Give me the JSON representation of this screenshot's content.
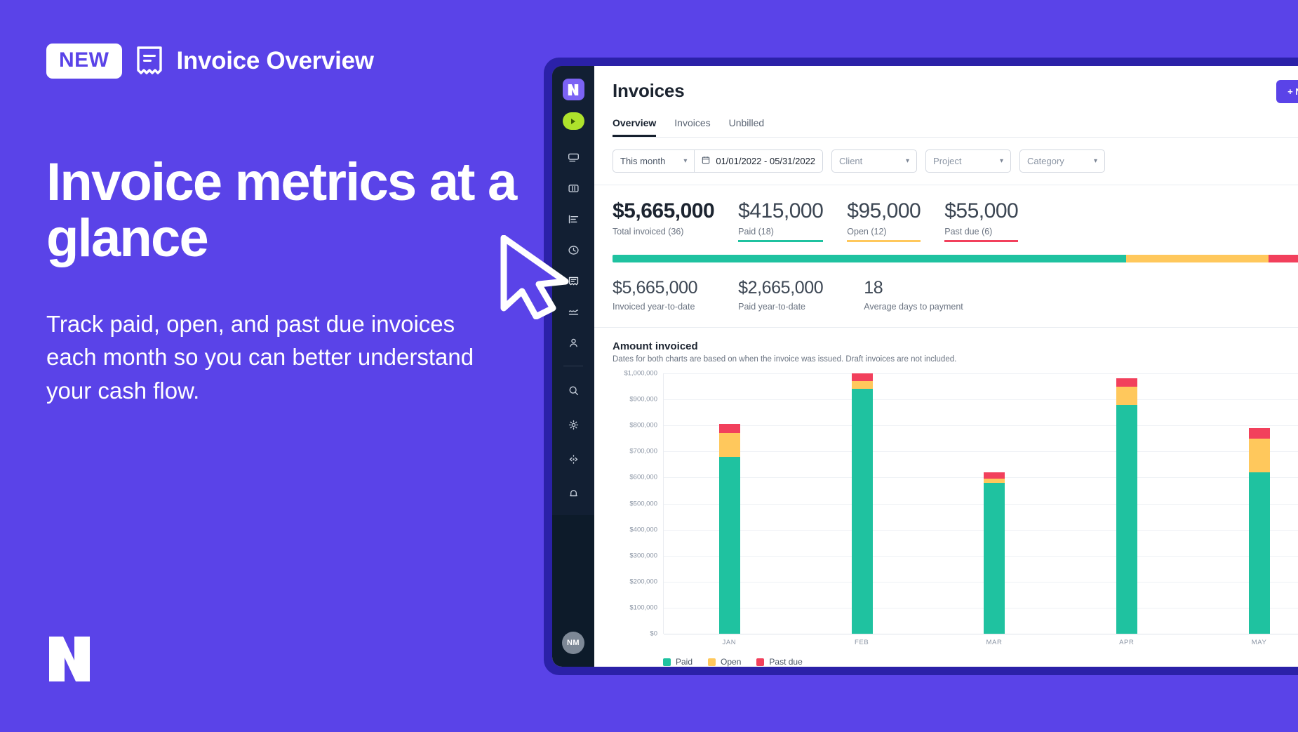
{
  "promo": {
    "badge_new": "NEW",
    "badge_icon": "invoice-document-icon",
    "badge_title": "Invoice Overview",
    "headline": "Invoice metrics at a glance",
    "subcopy": "Track paid, open, and past due invoices each month so you can better understand your cash flow.",
    "logo_icon": "brand-logo-icon",
    "background": "#5a43e8"
  },
  "app": {
    "sidebar": {
      "logo": "app-logo",
      "play": "play-button",
      "items": [
        {
          "icon": "monitor-icon"
        },
        {
          "icon": "board-icon"
        },
        {
          "icon": "task-list-icon"
        },
        {
          "icon": "clock-icon"
        },
        {
          "icon": "invoice-icon"
        },
        {
          "icon": "chart-line-icon"
        },
        {
          "icon": "person-icon"
        }
      ],
      "utility": [
        {
          "icon": "search-icon"
        },
        {
          "icon": "gear-icon"
        },
        {
          "icon": "code-icon"
        },
        {
          "icon": "bell-icon"
        }
      ],
      "avatar_initials": "NM"
    },
    "header": {
      "title": "Invoices",
      "new_button": "+ New",
      "tabs": [
        {
          "label": "Overview",
          "active": true
        },
        {
          "label": "Invoices",
          "active": false
        },
        {
          "label": "Unbilled",
          "active": false
        }
      ]
    },
    "filters": {
      "period": "This month",
      "date_range": "01/01/2022 - 05/31/2022",
      "calendar_icon": "calendar-icon",
      "client": "Client",
      "project": "Project",
      "category": "Category"
    },
    "kpis": [
      {
        "value": "$5,665,000",
        "label": "Total invoiced (36)",
        "underline": "none"
      },
      {
        "value": "$415,000",
        "label": "Paid (18)",
        "underline": "paid"
      },
      {
        "value": "$95,000",
        "label": "Open (12)",
        "underline": "open"
      },
      {
        "value": "$55,000",
        "label": "Past due (6)",
        "underline": "due"
      }
    ],
    "progress": [
      {
        "name": "Paid",
        "pct": 72,
        "color": "#1fc2a0"
      },
      {
        "name": "Open",
        "pct": 20,
        "color": "#ffc85c"
      },
      {
        "name": "Past due",
        "pct": 8,
        "color": "#f2405c"
      }
    ],
    "substats": [
      {
        "value": "$5,665,000",
        "label": "Invoiced year-to-date"
      },
      {
        "value": "$2,665,000",
        "label": "Paid year-to-date"
      },
      {
        "value": "18",
        "label": "Average days to payment"
      }
    ]
  },
  "chart_data": {
    "type": "bar",
    "title": "Amount invoiced",
    "subtitle": "Dates for both charts are based on when the invoice was issued. Draft invoices are not included.",
    "stacked": true,
    "categories": [
      "JAN",
      "FEB",
      "MAR",
      "APR",
      "MAY"
    ],
    "series": [
      {
        "name": "Paid",
        "color": "#1fc2a0",
        "values": [
          680000,
          940000,
          580000,
          880000,
          620000
        ]
      },
      {
        "name": "Open",
        "color": "#ffc85c",
        "values": [
          90000,
          30000,
          15000,
          70000,
          130000
        ]
      },
      {
        "name": "Past due",
        "color": "#f2405c",
        "values": [
          35000,
          30000,
          25000,
          30000,
          40000
        ]
      }
    ],
    "ylim": [
      0,
      1000000
    ],
    "ytick_labels": [
      "$1,000,000",
      "$900,000",
      "$800,000",
      "$700,000",
      "$600,000",
      "$500,000",
      "$400,000",
      "$300,000",
      "$200,000",
      "$100,000",
      "$0"
    ],
    "ytick_values": [
      1000000,
      900000,
      800000,
      700000,
      600000,
      500000,
      400000,
      300000,
      200000,
      100000,
      0
    ],
    "xlabel": "",
    "ylabel": "",
    "grid": true,
    "legend_position": "bottom-left",
    "legend": [
      "Paid",
      "Open",
      "Past due"
    ]
  }
}
